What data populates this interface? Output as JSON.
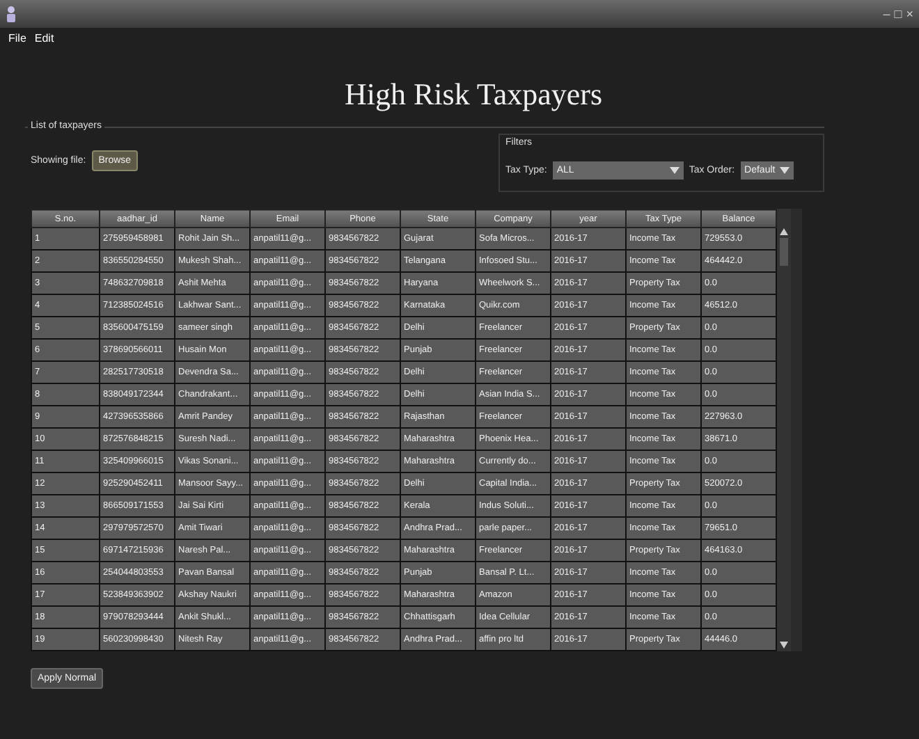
{
  "window": {
    "controls": [
      "–",
      "□",
      "×"
    ]
  },
  "menu": [
    "File",
    "Edit"
  ],
  "heading": "High Risk Taxpayers",
  "taxpayer_list": {
    "label": "List of taxpayers",
    "file_label": "Showing file:",
    "browse_button": "Browse"
  },
  "filters": {
    "label": "Filters",
    "tax_type_label": "Tax Type:",
    "tax_type": "ALL",
    "tax_order_label": "Tax Order:",
    "tax_order": "Default"
  },
  "table": {
    "columns": [
      "S.no.",
      "aadhar_id",
      "Name",
      "Email",
      "Phone",
      "State",
      "Company",
      "year",
      "Tax Type",
      "Balance"
    ],
    "rows": [
      [
        "1",
        "275959458981",
        "Rohit Jain Sh...",
        "anpatil11@g...",
        "9834567822",
        "Gujarat",
        "Sofa Micros...",
        "2016-17",
        "Income Tax",
        "729553.0"
      ],
      [
        "2",
        "836550284550",
        "Mukesh Shah...",
        "anpatil11@g...",
        "9834567822",
        "Telangana",
        "Infosoed Stu...",
        "2016-17",
        "Income Tax",
        "464442.0"
      ],
      [
        "3",
        "748632709818",
        "Ashit Mehta",
        "anpatil11@g...",
        "9834567822",
        "Haryana",
        "Wheelwork S...",
        "2016-17",
        "Property Tax",
        "0.0"
      ],
      [
        "4",
        "712385024516",
        "Lakhwar Sant...",
        "anpatil11@g...",
        "9834567822",
        "Karnataka",
        "Quikr.com",
        "2016-17",
        "Income Tax",
        "46512.0"
      ],
      [
        "5",
        "835600475159",
        "sameer singh",
        "anpatil11@g...",
        "9834567822",
        "Delhi",
        "Freelancer",
        "2016-17",
        "Property Tax",
        "0.0"
      ],
      [
        "6",
        "378690566011",
        "Husain Mon",
        "anpatil11@g...",
        "9834567822",
        "Punjab",
        "Freelancer",
        "2016-17",
        "Income Tax",
        "0.0"
      ],
      [
        "7",
        "282517730518",
        "Devendra Sa...",
        "anpatil11@g...",
        "9834567822",
        "Delhi",
        "Freelancer",
        "2016-17",
        "Income Tax",
        "0.0"
      ],
      [
        "8",
        "838049172344",
        "Chandrakant...",
        "anpatil11@g...",
        "9834567822",
        "Delhi",
        "Asian India S...",
        "2016-17",
        "Income Tax",
        "0.0"
      ],
      [
        "9",
        "427396535866",
        "Amrit Pandey",
        "anpatil11@g...",
        "9834567822",
        "Rajasthan",
        "Freelancer",
        "2016-17",
        "Income Tax",
        "227963.0"
      ],
      [
        "10",
        "872576848215",
        "Suresh Nadi...",
        "anpatil11@g...",
        "9834567822",
        "Maharashtra",
        "Phoenix Hea...",
        "2016-17",
        "Income Tax",
        "38671.0"
      ],
      [
        "11",
        "325409966015",
        "Vikas Sonani...",
        "anpatil11@g...",
        "9834567822",
        "Maharashtra",
        "Currently do...",
        "2016-17",
        "Income Tax",
        "0.0"
      ],
      [
        "12",
        "925290452411",
        "Mansoor Sayy...",
        "anpatil11@g...",
        "9834567822",
        "Delhi",
        "Capital India...",
        "2016-17",
        "Property Tax",
        "520072.0"
      ],
      [
        "13",
        "866509171553",
        "Jai Sai Kirti",
        "anpatil11@g...",
        "9834567822",
        "Kerala",
        "Indus Soluti...",
        "2016-17",
        "Income Tax",
        "0.0"
      ],
      [
        "14",
        "297979572570",
        "Amit Tiwari",
        "anpatil11@g...",
        "9834567822",
        "Andhra Prad...",
        "parle paper...",
        "2016-17",
        "Income Tax",
        "79651.0"
      ],
      [
        "15",
        "697147215936",
        "Naresh Pal...",
        "anpatil11@g...",
        "9834567822",
        "Maharashtra",
        "Freelancer",
        "2016-17",
        "Property Tax",
        "464163.0"
      ],
      [
        "16",
        "254044803553",
        "Pavan Bansal",
        "anpatil11@g...",
        "9834567822",
        "Punjab",
        "Bansal P. Lt...",
        "2016-17",
        "Income Tax",
        "0.0"
      ],
      [
        "17",
        "523849363902",
        "Akshay Naukri",
        "anpatil11@g...",
        "9834567822",
        "Maharashtra",
        "Amazon",
        "2016-17",
        "Income Tax",
        "0.0"
      ],
      [
        "18",
        "979078293444",
        "Ankit Shukl...",
        "anpatil11@g...",
        "9834567822",
        "Chhattisgarh",
        "Idea Cellular",
        "2016-17",
        "Income Tax",
        "0.0"
      ],
      [
        "19",
        "560230998430",
        "Nitesh Ray",
        "anpatil11@g...",
        "9834567822",
        "Andhra Prad...",
        "affin pro ltd",
        "2016-17",
        "Property Tax",
        "44446.0"
      ]
    ]
  },
  "apply_button": "Apply Normal"
}
